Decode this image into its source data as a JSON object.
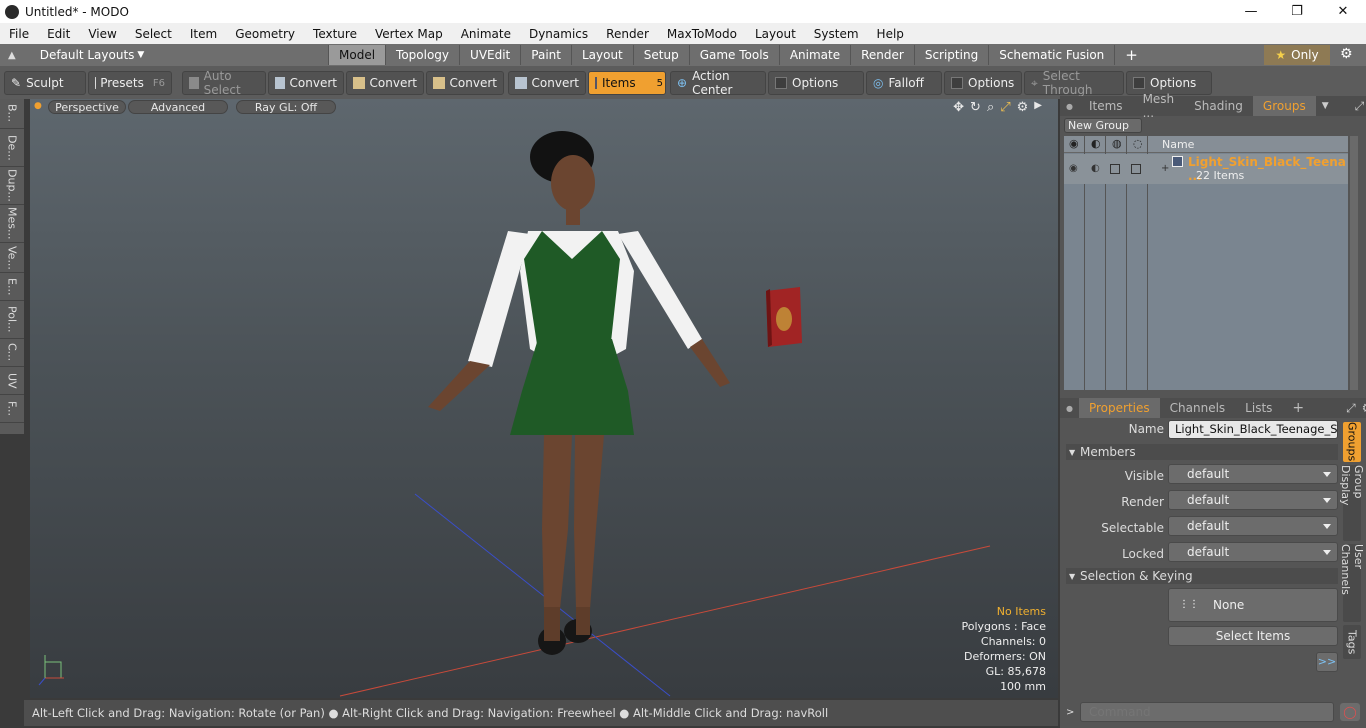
{
  "window": {
    "title": "Untitled* - MODO",
    "controls": [
      "—",
      "❐",
      "✕"
    ]
  },
  "menu": [
    "File",
    "Edit",
    "View",
    "Select",
    "Item",
    "Geometry",
    "Texture",
    "Vertex Map",
    "Animate",
    "Dynamics",
    "Render",
    "MaxToModo",
    "Layout",
    "System",
    "Help"
  ],
  "layoutbar": {
    "default_layouts": "Default Layouts",
    "tabs": [
      "Model",
      "Topology",
      "UVEdit",
      "Paint",
      "Layout",
      "Setup",
      "Game Tools",
      "Animate",
      "Render",
      "Scripting",
      "Schematic Fusion"
    ],
    "active_tab": "Model",
    "add": "+",
    "only": "Only"
  },
  "toolbar": {
    "sculpt": "Sculpt",
    "presets": "Presets",
    "presets_key": "F6",
    "auto_select": "Auto Select",
    "convert1": "Convert",
    "convert2": "Convert",
    "convert3": "Convert",
    "convert4": "Convert",
    "items": "Items",
    "items_key": "5",
    "action_center": "Action Center",
    "options1": "Options",
    "falloff": "Falloff",
    "options2": "Options",
    "select_through": "Select Through",
    "options3": "Options"
  },
  "leftstrip": [
    "B...",
    "De...",
    "Dup...",
    "Mes...",
    "Ve...",
    "E...",
    "Pol...",
    "C...",
    "UV",
    "F..."
  ],
  "viewport": {
    "perspective": "Perspective",
    "advanced": "Advanced",
    "raygl": "Ray GL: Off",
    "stats": {
      "no_items": "No Items",
      "polygons": "Polygons : Face",
      "channels": "Channels: 0",
      "deformers": "Deformers: ON",
      "gl": "GL: 85,678",
      "scale": "100 mm"
    }
  },
  "statusbar": "Alt-Left Click and Drag: Navigation: Rotate (or Pan) ● Alt-Right Click and Drag: Navigation: Freewheel ● Alt-Middle Click and Drag: navRoll",
  "groups_panel": {
    "tabs": [
      "Items",
      "Mesh ...",
      "Shading",
      "Groups"
    ],
    "active_tab": "Groups",
    "new_group": "New Group",
    "column_name": "Name",
    "row_name": "Light_Skin_Black_Teena ...",
    "row_count": "22 Items"
  },
  "properties_panel": {
    "tabs": [
      "Properties",
      "Channels",
      "Lists"
    ],
    "active_tab": "Properties",
    "add": "+",
    "name_label": "Name",
    "name_value": "Light_Skin_Black_Teenage_Schoo",
    "members_header": "Members",
    "visible_label": "Visible",
    "visible_value": "default",
    "render_label": "Render",
    "render_value": "default",
    "selectable_label": "Selectable",
    "selectable_value": "default",
    "locked_label": "Locked",
    "locked_value": "default",
    "selkey_header": "Selection & Keying",
    "none_button": "None",
    "select_items_button": "Select Items",
    "more_button": ">>",
    "side_tabs": [
      "Groups",
      "Group Display",
      "User Channels",
      "Tags"
    ]
  },
  "command": {
    "placeholder": "Command"
  }
}
